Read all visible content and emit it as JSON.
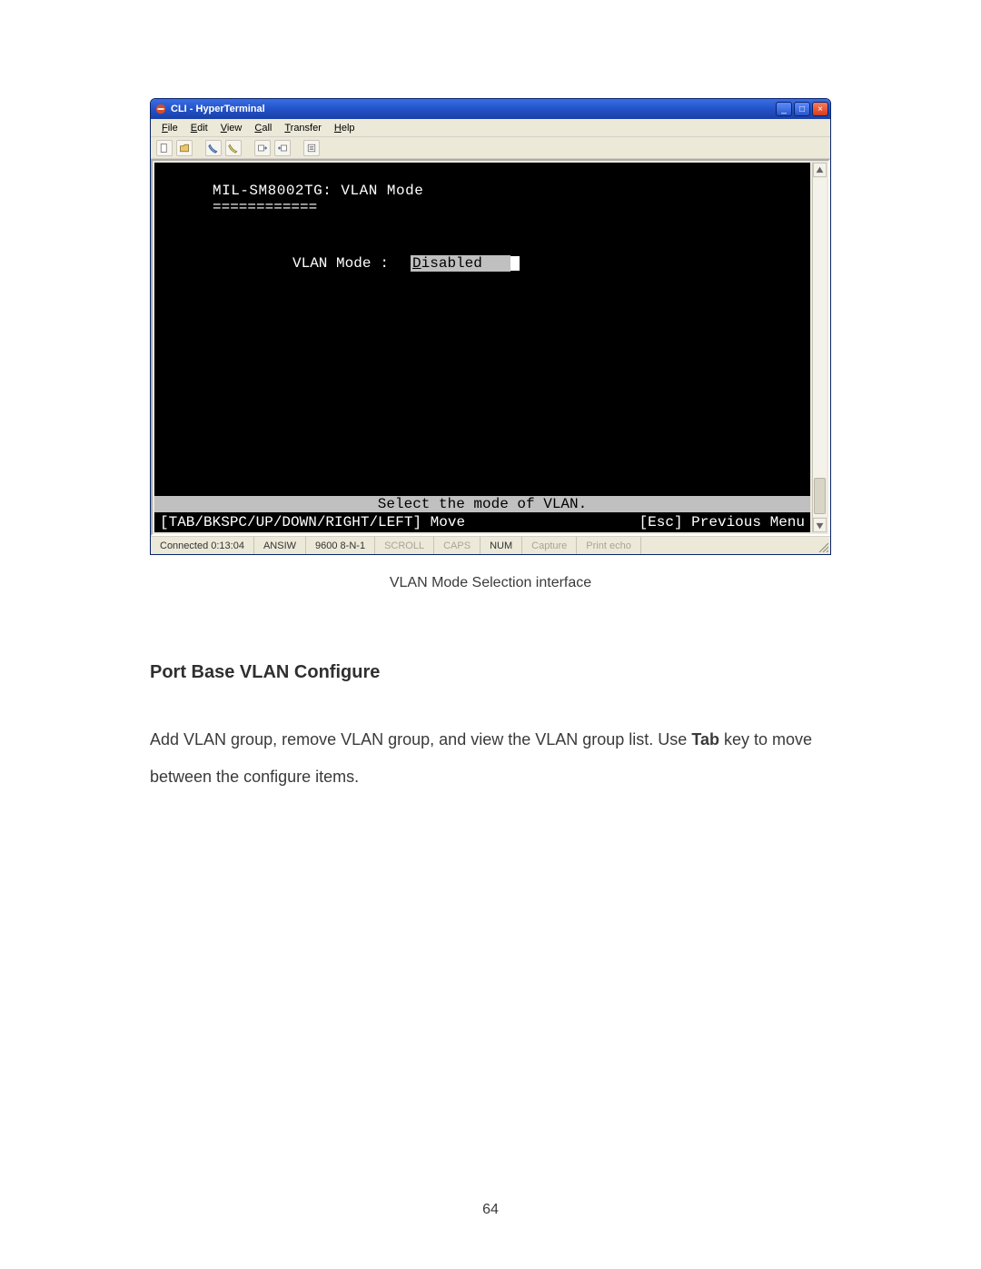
{
  "window": {
    "title": "CLI - HyperTerminal",
    "menus": {
      "file": "File",
      "edit": "Edit",
      "view": "View",
      "call": "Call",
      "transfer": "Transfer",
      "help": "Help"
    },
    "buttons": {
      "minimize": "_",
      "maximize": "□",
      "close": "×"
    }
  },
  "terminal": {
    "header": "MIL-SM8002TG: VLAN Mode",
    "separator": "============",
    "field_label": "VLAN Mode",
    "field_colon": ":",
    "field_value": "Disabled",
    "field_value_underlined_first": "D",
    "field_value_rest": "isabled",
    "prompt_banner": "Select the mode of VLAN.",
    "hint_left": "[TAB/BKSPC/UP/DOWN/RIGHT/LEFT] Move",
    "hint_right": "[Esc] Previous Menu"
  },
  "statusbar": {
    "connected": "Connected 0:13:04",
    "encoding": "ANSIW",
    "port": "9600 8-N-1",
    "scroll": "SCROLL",
    "caps": "CAPS",
    "num": "NUM",
    "capture": "Capture",
    "print_echo": "Print echo"
  },
  "caption": "VLAN Mode Selection interface",
  "heading": "Port Base VLAN Configure",
  "body": {
    "pre": "Add VLAN group, remove VLAN group, and view the VLAN group list. Use ",
    "bold": "Tab",
    "post": " key to move between the configure items."
  },
  "page_number": "64"
}
